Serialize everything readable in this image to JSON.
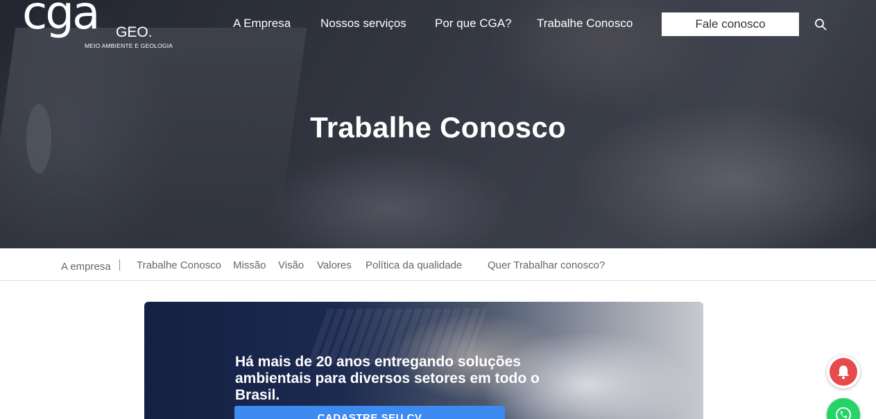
{
  "logo": {
    "main": "cga",
    "suffix": "GEO.",
    "tagline": "MEIO AMBIENTE E GEOLOGIA"
  },
  "nav": {
    "items": [
      "A Empresa",
      "Nossos serviços",
      "Por que CGA?",
      "Trabalhe Conosco"
    ],
    "cta_label": "Fale conosco"
  },
  "hero": {
    "title": "Trabalhe Conosco"
  },
  "subnav": {
    "items": [
      "A empresa",
      "Trabalhe Conosco",
      "Missão",
      "Visão",
      "Valores",
      "Política da qualidade",
      "Quer Trabalhar conosco?"
    ]
  },
  "banner": {
    "text": "Há mais de 20 anos entregando soluções ambientais para diversos setores em todo o Brasil.",
    "button_label": "CADASTRE SEU CV"
  },
  "colors": {
    "cta_background": "#ffffff",
    "banner_button": "#3d8af0",
    "notification": "#e54b4b",
    "whatsapp": "#25d366"
  },
  "icons": {
    "search": "search-icon",
    "notification": "bell-icon",
    "whatsapp": "whatsapp-icon"
  }
}
